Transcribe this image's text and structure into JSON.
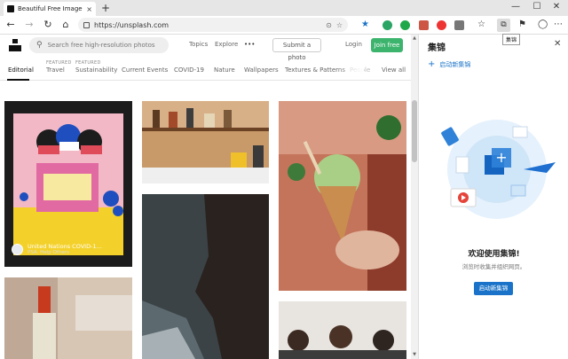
{
  "browser": {
    "tab_title": "Beautiful Free Images & Pictures",
    "tab_close": "×",
    "new_tab": "+",
    "url": "https://unsplash.com",
    "tooltip": "集锦",
    "window_minimize": "—",
    "window_maximize": "☐",
    "window_close": "✕",
    "nav_back": "←",
    "nav_forward": "→",
    "nav_refresh": "↻",
    "nav_home": "⌂"
  },
  "site": {
    "search_placeholder": "Search free high-resolution photos",
    "nav_topics": "Topics",
    "nav_explore": "Explore",
    "nav_more": "•••",
    "submit_photo": "Submit a photo",
    "login": "Login",
    "join_free": "Join free",
    "categories": [
      {
        "label": "Editorial",
        "featured": ""
      },
      {
        "label": "Travel",
        "featured": "FEATURED"
      },
      {
        "label": "Sustainability",
        "featured": "FEATURED"
      },
      {
        "label": "Current Events",
        "featured": ""
      },
      {
        "label": "COVID-19",
        "featured": ""
      },
      {
        "label": "Nature",
        "featured": ""
      },
      {
        "label": "Wallpapers",
        "featured": ""
      },
      {
        "label": "Textures & Patterns",
        "featured": ""
      },
      {
        "label": "People",
        "featured": ""
      }
    ],
    "view_all": "View all",
    "featured_tile": {
      "name": "United Nations COVID-1...",
      "subtitle": "PSA: Help Others"
    }
  },
  "collections": {
    "title": "集锦",
    "close": "✕",
    "start_new_link": "启动新集锦",
    "welcome_title": "欢迎使用集锦!",
    "welcome_subtitle": "浏览时收集并组织网页。",
    "start_button": "启动新集锦"
  },
  "colors": {
    "join_button": "#3cb46e",
    "collections_accent": "#1a73c8"
  }
}
